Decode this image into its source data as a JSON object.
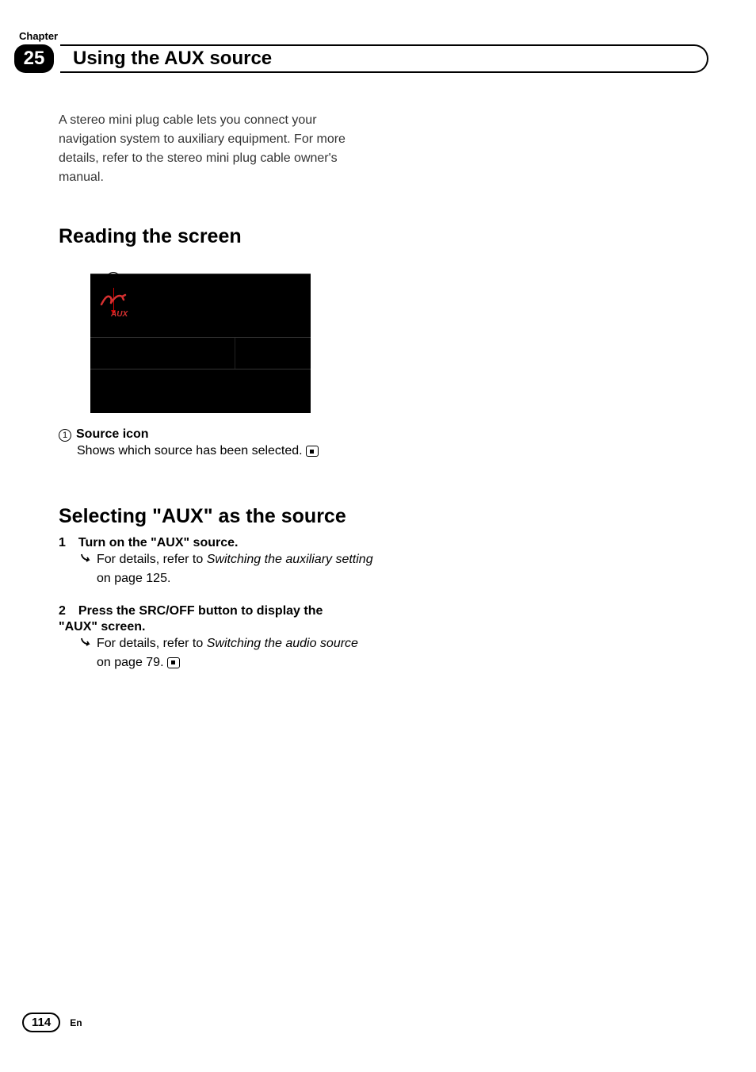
{
  "chapter": {
    "label": "Chapter",
    "number": "25",
    "title": "Using the AUX source"
  },
  "intro": "A stereo mini plug cable lets you connect your navigation system to auxiliary equipment. For more details, refer to the stereo mini plug cable owner's manual.",
  "section1": {
    "heading": "Reading the screen",
    "callout_num": "1",
    "aux_label": "AUX",
    "legend_num": "1",
    "legend_title": "Source icon",
    "legend_desc": "Shows which source has been selected."
  },
  "section2": {
    "heading_pre": "Selecting \"",
    "heading_mid": "AUX",
    "heading_post": "\" as the source",
    "step1_num": "1",
    "step1_title": "Turn on the \"AUX\" source.",
    "step1_detail_pre": "For details, refer to ",
    "step1_detail_italic": "Switching the auxiliary setting",
    "step1_detail_post": " on page 125.",
    "step2_num": "2",
    "step2_title_line1": "Press the SRC/OFF button to display the",
    "step2_title_line2": "\"AUX\" screen.",
    "step2_detail_pre": "For details, refer to ",
    "step2_detail_italic": "Switching the audio source",
    "step2_detail_post": " on page 79."
  },
  "footer": {
    "page": "114",
    "lang": "En"
  }
}
